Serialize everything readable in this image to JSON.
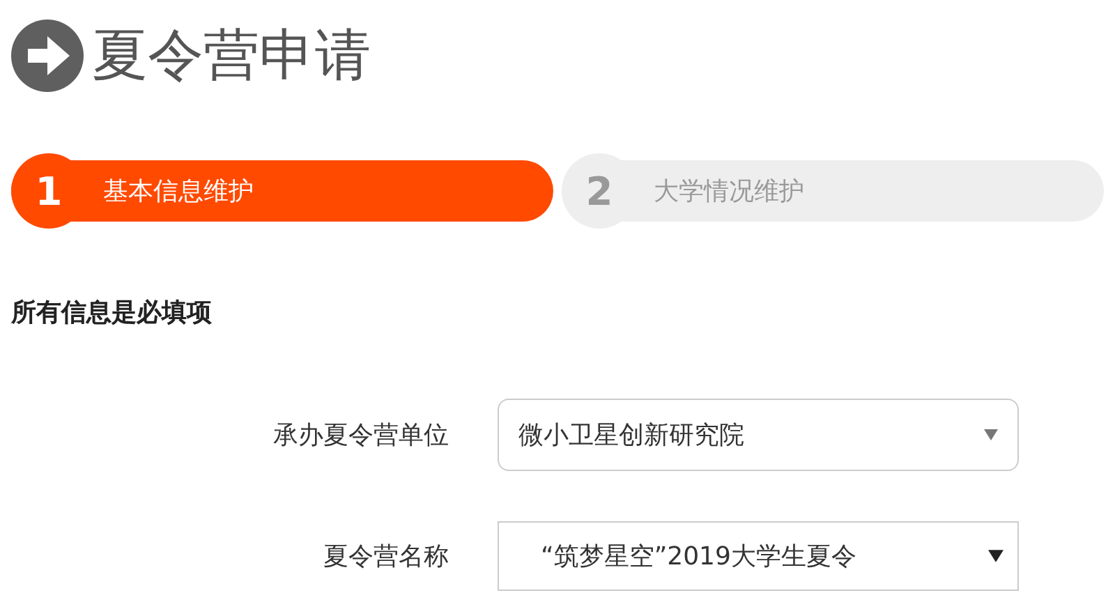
{
  "title": "夏令营申请",
  "steps": [
    {
      "number": "1",
      "label": "基本信息维护",
      "selected": true
    },
    {
      "number": "2",
      "label": "大学情况维护",
      "selected": false
    }
  ],
  "notice": "所有信息是必填项",
  "fields": [
    {
      "label": "承办夏令营单位",
      "value": "微小卫星创新研究院",
      "kind": "rounded"
    },
    {
      "label": "夏令营名称",
      "value": "“筑梦星空”2019大学生夏令",
      "kind": "native"
    }
  ]
}
